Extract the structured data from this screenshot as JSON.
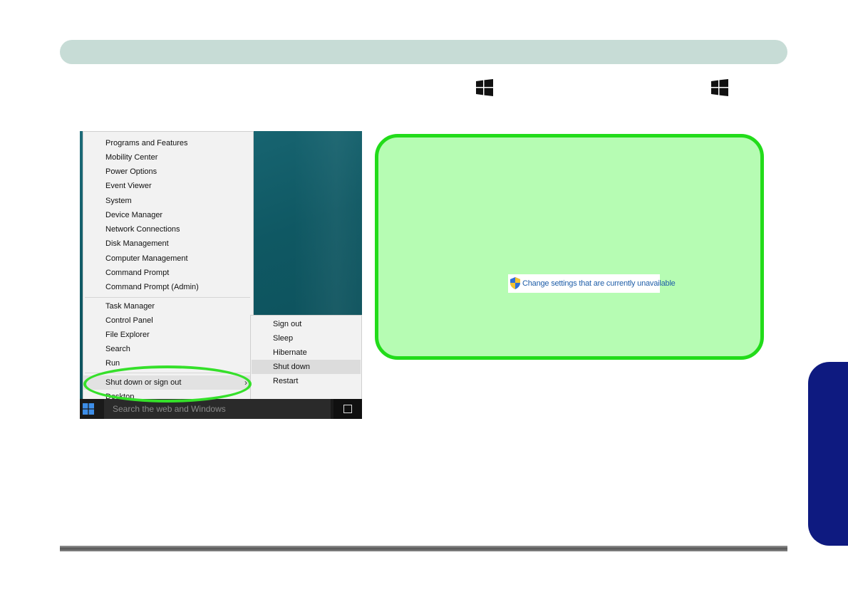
{
  "winx_menu": {
    "group1": [
      "Programs and Features",
      "Mobility Center",
      "Power Options",
      "Event Viewer",
      "System",
      "Device Manager",
      "Network Connections",
      "Disk Management",
      "Computer Management",
      "Command Prompt",
      "Command Prompt (Admin)"
    ],
    "group2": [
      "Task Manager",
      "Control Panel",
      "File Explorer",
      "Search",
      "Run"
    ],
    "shutdown_item": "Shut down or sign out",
    "shutdown_arrow": "›",
    "desktop_item": "Desktop"
  },
  "shutdown_submenu": {
    "items": [
      "Sign out",
      "Sleep",
      "Hibernate",
      "Shut down",
      "Restart"
    ],
    "highlighted": "Shut down"
  },
  "taskbar": {
    "search_text": "Search the web and Windows"
  },
  "green_box": {
    "link_text": "Change settings that are currently unavailable"
  },
  "colors": {
    "header_bar": "#c7dcd6",
    "green_fill": "#b6fcb3",
    "green_border": "#22dc1a",
    "side_tab": "#0e1a80"
  }
}
